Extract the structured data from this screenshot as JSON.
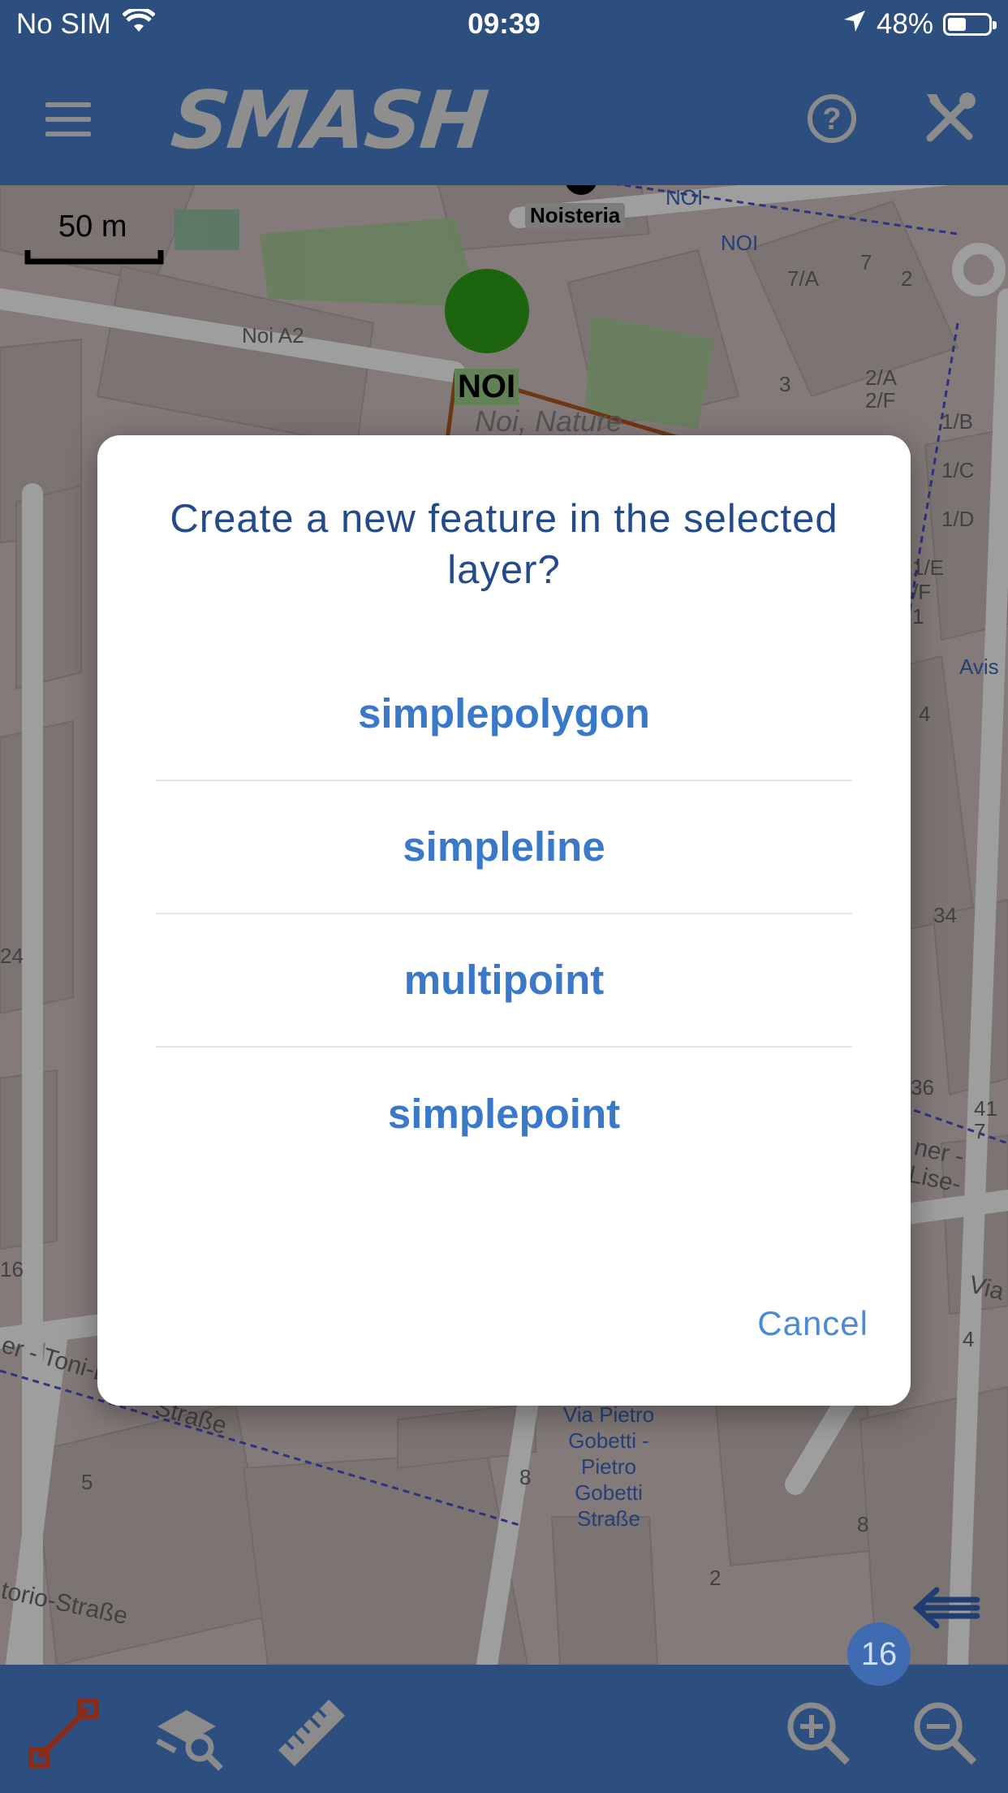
{
  "status_bar": {
    "carrier": "No SIM",
    "time": "09:39",
    "battery_percent": "48%"
  },
  "app_bar": {
    "title": "SMASH",
    "menu_icon": "hamburger-icon",
    "help_icon": "help-circle-icon",
    "settings_icon": "tools-icon"
  },
  "map": {
    "scale_label": "50 m",
    "labels": {
      "noisteria": "Noisteria",
      "noi_a2": "Noi A2",
      "noi": "NOI",
      "noi_nature": "Noi, Nature",
      "noi_road1": "NOI",
      "noi_road2": "NOI",
      "avis": "Avis",
      "via_pietro": "Via Pietro Gobetti - Pietro Gobetti Straße",
      "strasse": "Straße",
      "toni": "er - Toni-E",
      "torio": "torio-Straße",
      "lise": "ner - Lise-",
      "via": "Via",
      "n7a": "7/A",
      "n7": "7",
      "n2": "2",
      "n3": "3",
      "n2a": "2/A",
      "n2f": "2/F",
      "n1b": "1/B",
      "n1c": "1/C",
      "n1d": "1/D",
      "n1e": "1/E",
      "nf": "/F",
      "n1": "1",
      "n4": "4",
      "n34": "34",
      "n24": "24",
      "n36": "36",
      "n41": "41",
      "n7b": "7",
      "n16": "16",
      "n5": "5",
      "n8": "8",
      "n8b": "8",
      "n2b": "2",
      "n4b": "4"
    },
    "zoom_level": "16"
  },
  "dialog": {
    "title": "Create a new feature in the selected layer?",
    "options": [
      "simplepolygon",
      "simpleline",
      "multipoint",
      "simplepoint"
    ],
    "cancel_label": "Cancel"
  },
  "bottom_bar": {
    "tools": [
      "edit-geometry-icon",
      "query-layer-icon",
      "ruler-icon",
      "zoom-in-icon",
      "zoom-out-icon"
    ]
  },
  "colors": {
    "app_bar": "#2c4f80",
    "dialog_title": "#234a8a",
    "option_text": "#3a78c9",
    "cancel_text": "#4a8ad6"
  }
}
